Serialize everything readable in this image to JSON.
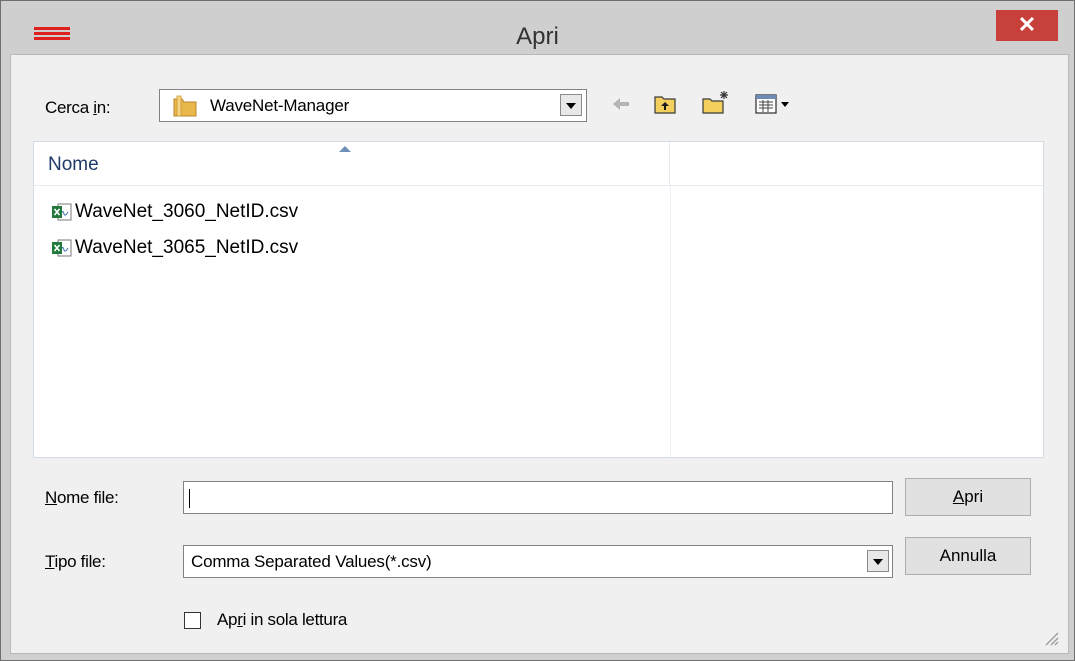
{
  "window": {
    "title": "Apri",
    "close_glyph": "✕",
    "app_icon": "hamburger-red-icon"
  },
  "look_in": {
    "label_pre": "Cerca ",
    "label_u": "i",
    "label_post": "n:",
    "folder_icon": "folder-icon",
    "value": "WaveNet-Manager"
  },
  "toolbar": {
    "back_icon": "back-arrow-icon",
    "up_icon": "up-folder-icon",
    "new_folder_icon": "new-folder-icon",
    "view_menu_icon": "view-menu-icon"
  },
  "file_list": {
    "columns": [
      "Nome",
      ""
    ],
    "items": [
      {
        "name": "WaveNet_3060_NetID.csv",
        "icon": "excel-csv-icon"
      },
      {
        "name": "WaveNet_3065_NetID.csv",
        "icon": "excel-csv-icon"
      }
    ]
  },
  "file_name": {
    "label_u": "N",
    "label_post": "ome file:",
    "value": ""
  },
  "file_type": {
    "label_u": "T",
    "label_post": "ipo file:",
    "value": "Comma Separated Values(*.csv)"
  },
  "buttons": {
    "open_u": "A",
    "open_post": "pri",
    "cancel": "Annulla"
  },
  "readonly": {
    "label_pre": "Ap",
    "label_u": "r",
    "label_post": "i in sola lettura",
    "checked": false
  },
  "colors": {
    "close_red": "#c7403b",
    "header_text": "#1e3a66",
    "app_icon_red": "#e0201f"
  }
}
